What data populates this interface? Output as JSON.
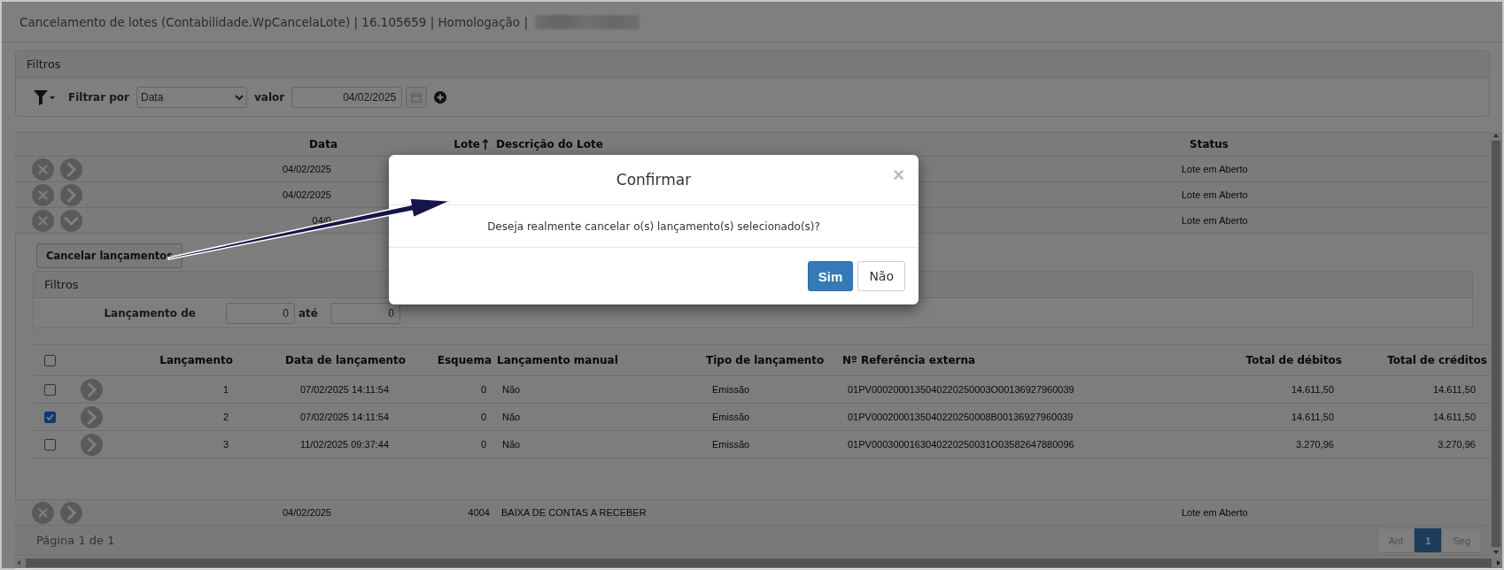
{
  "window": {
    "title": "Cancelamento de lotes (Contabilidade.WpCancelaLote) | 16.105659 | Homologação |"
  },
  "filters": {
    "title": "Filtros",
    "filter_by_label": "Filtrar por",
    "filter_by_value": "Data",
    "value_label": "valor",
    "value": "04/02/2025"
  },
  "lots": {
    "columns": [
      {
        "label": "Data",
        "sorted": false
      },
      {
        "label": "Lote",
        "sorted": true
      },
      {
        "label": "Descrição do Lote",
        "sorted": false
      },
      {
        "label": "Status",
        "sorted": false
      }
    ],
    "rows": [
      {
        "date": "04/02/2025",
        "status": "Lote em Aberto",
        "expanded": false
      },
      {
        "date": "04/02/2025",
        "status": "Lote em Aberto",
        "expanded": false
      },
      {
        "date": "04/0",
        "status": "Lote em Aberto",
        "expanded": true,
        "detail": {
          "action_button": "Cancelar lançamentos",
          "filters": {
            "title": "Filtros",
            "from_label": "Lançamento de",
            "from_value": "0",
            "to_label": "até",
            "to_value": "0"
          },
          "select_all": {
            "checked": false
          },
          "columns": [
            "Lançamento",
            "Data de lançamento",
            "Esquema",
            "Lançamento manual",
            "Tipo de lançamento",
            "Nº Referência externa",
            "Total de débitos",
            "Total de créditos"
          ],
          "rows": [
            {
              "checked": false,
              "cells": [
                "1",
                "07/02/2025 14:11:54",
                "0",
                "Não",
                "Emissão",
                "01PV0002000135040220250003O00136927960039",
                "14.611,50",
                "14.611,50"
              ]
            },
            {
              "checked": true,
              "cells": [
                "2",
                "07/02/2025 14:11:54",
                "0",
                "Não",
                "Emissão",
                "01PV0002000135040220250008B00136927960039",
                "14.611,50",
                "14.611,50"
              ]
            },
            {
              "checked": false,
              "cells": [
                "3",
                "11/02/2025 09:37:44",
                "0",
                "Não",
                "Emissão",
                "01PV0003000163040220250031O03582647880096",
                "3.270,96",
                "3.270,96"
              ]
            }
          ]
        }
      },
      {
        "date": "04/02/2025",
        "lot": "4004",
        "description": "BAIXA DE CONTAS A RECEBER",
        "status": "Lote em Aberto",
        "expanded": false
      }
    ]
  },
  "pagination": {
    "label": "Página 1 de 1",
    "pages": [
      {
        "label": "Ant",
        "selected": false
      },
      {
        "label": "1",
        "selected": true
      },
      {
        "label": "Seg",
        "selected": false
      }
    ]
  },
  "modal": {
    "title": "Confirmar",
    "close": "×",
    "message": "Deseja realmente cancelar o(s) lançamento(s) selecionado(s)?",
    "buttons": [
      {
        "label": "Sim",
        "kind": "primary"
      },
      {
        "label": "Não",
        "kind": "default"
      }
    ]
  }
}
